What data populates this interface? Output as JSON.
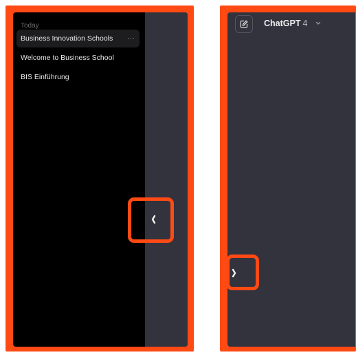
{
  "left_panel": {
    "section_label": "Today",
    "chats": [
      {
        "title": "Business Innovation Schools",
        "active": true,
        "more": "···"
      },
      {
        "title": "Welcome to Business School",
        "active": false
      },
      {
        "title": "BIS Einführung",
        "active": false
      }
    ],
    "toggle_icon": "chevron-left-icon"
  },
  "right_panel": {
    "new_chat_icon": "edit-square-icon",
    "model_name": "ChatGPT",
    "model_version": "4",
    "model_caret_icon": "chevron-down-icon",
    "toggle_icon": "chevron-right-icon"
  },
  "colors": {
    "highlight": "#ff4a14",
    "sidebar_bg": "#000000",
    "main_bg": "#33333e",
    "active_item_bg": "#1d1d1f",
    "text": "#e8e8e8"
  }
}
